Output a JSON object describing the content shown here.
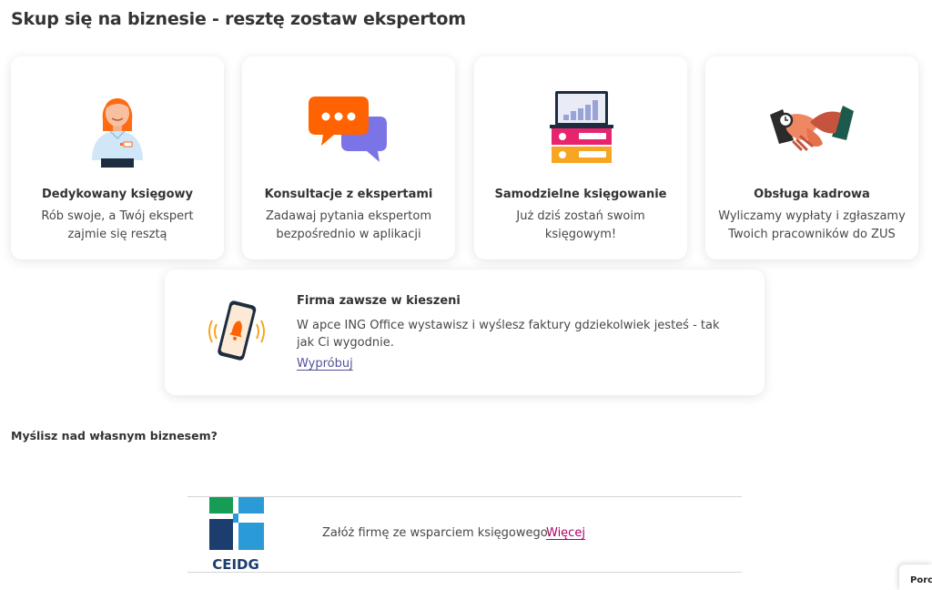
{
  "page": {
    "title": "Skup się na biznesie - resztę zostaw ekspertom"
  },
  "cards": [
    {
      "icon": "accountant-woman-icon",
      "title": "Dedykowany księgowy",
      "description": "Rób swoje, a Twój ekspert zajmie się resztą"
    },
    {
      "icon": "chat-bubbles-icon",
      "title": "Konsultacje z ekspertami",
      "description": "Zadawaj pytania ekspertom bezpośrednio w aplikacji"
    },
    {
      "icon": "laptop-binders-icon",
      "title": "Samodzielne księgowanie",
      "description": "Już dziś zostań swoim księgowym!"
    },
    {
      "icon": "handshake-icon",
      "title": "Obsługa kadrowa",
      "description": "Wyliczamy wypłaty i zgłaszamy Twoich pracowników do ZUS"
    }
  ],
  "promo": {
    "icon": "phone-notification-icon",
    "title": "Firma zawsze w kieszeni",
    "description": "W apce ING Office wystawisz i wyślesz faktury gdziekolwiek jesteś - tak jak Ci wygodnie.",
    "link_label": "Wypróbuj"
  },
  "business_section": {
    "heading": "Myślisz nad własnym biznesem?",
    "logo_text": "CEIDG",
    "text": "Załóż firmę ze wsparciem księgowego",
    "link_label": "Więcej"
  },
  "corner_tab": {
    "label": "Porc"
  },
  "colors": {
    "accent_orange": "#ff6200",
    "link_purple": "#525199",
    "link_magenta": "#ab0066",
    "ceidg_green": "#169c55",
    "ceidg_blue": "#2a9bd7",
    "ceidg_navy": "#1c3e6e"
  }
}
